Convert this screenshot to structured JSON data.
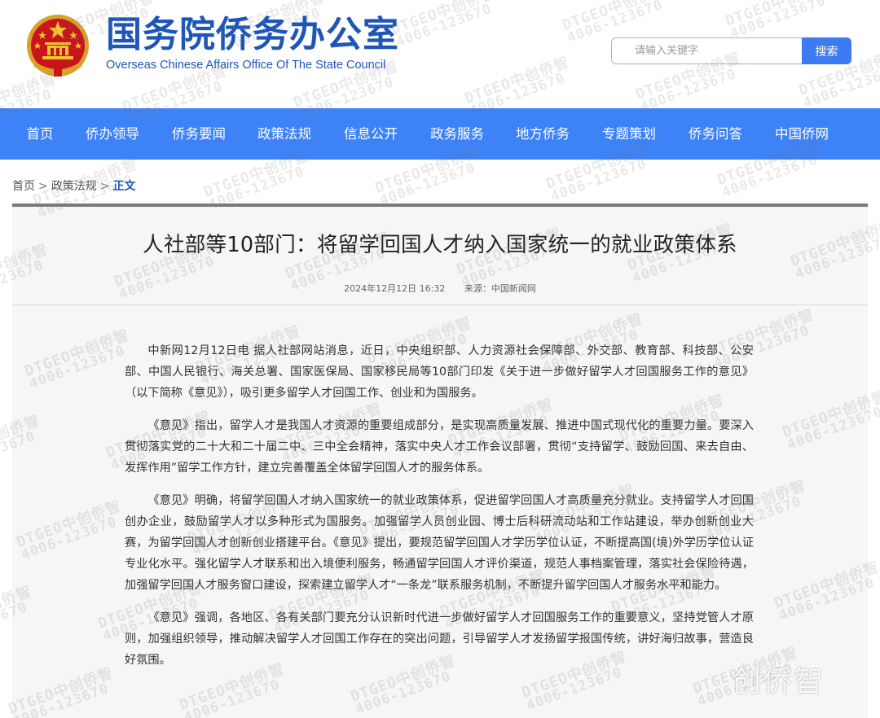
{
  "header": {
    "title": "国务院侨务办公室",
    "subtitle": "Overseas Chinese Affairs Office Of The State Council",
    "search_placeholder": "请输入关键字",
    "search_button": "搜索"
  },
  "nav": [
    {
      "label": "首页"
    },
    {
      "label": "侨办领导"
    },
    {
      "label": "侨务要闻"
    },
    {
      "label": "政策法规"
    },
    {
      "label": "信息公开"
    },
    {
      "label": "政务服务"
    },
    {
      "label": "地方侨务"
    },
    {
      "label": "专题策划"
    },
    {
      "label": "侨务问答"
    },
    {
      "label": "中国侨网"
    }
  ],
  "breadcrumb": {
    "home": "首页",
    "section": "政策法规",
    "current": "正文",
    "separator": ">"
  },
  "article": {
    "title": "人社部等10部门：将留学回国人才纳入国家统一的就业政策体系",
    "date": "2024年12月12日  16:32",
    "source": "来源：中国新闻网",
    "paragraphs": [
      "中新网12月12日电  据人社部网站消息，近日，中央组织部、人力资源社会保障部、外交部、教育部、科技部、公安部、中国人民银行、海关总署、国家医保局、国家移民局等10部门印发《关于进一步做好留学人才回国服务工作的意见》（以下简称《意见》），吸引更多留学人才回国工作、创业和为国服务。",
      "《意见》指出，留学人才是我国人才资源的重要组成部分，是实现高质量发展、推进中国式现代化的重要力量。要深入贯彻落实党的二十大和二十届二中、三中全会精神，落实中央人才工作会议部署，贯彻“支持留学、鼓励回国、来去自由、发挥作用”留学工作方针，建立完善覆盖全体留学回国人才的服务体系。",
      "《意见》明确，将留学回国人才纳入国家统一的就业政策体系，促进留学回国人才高质量充分就业。支持留学人才回国创办企业，鼓励留学人才以多种形式为国服务。加强留学人员创业园、博士后科研流动站和工作站建设，举办创新创业大赛，为留学回国人才创新创业搭建平台。《意见》提出，要规范留学回国人才学历学位认证，不断提高国(境)外学历学位认证专业化水平。强化留学人才联系和出入境便利服务，畅通留学回国人才评价渠道，规范人事档案管理，落实社会保险待遇，加强留学回国人才服务窗口建设，探索建立留学人才“一条龙”联系服务机制，不断提升留学回国人才服务水平和能力。",
      "《意见》强调，各地区、各有关部门要充分认识新时代进一步做好留学人才回国服务工作的重要意义，坚持党管人才原则，加强组织领导，推动解决留学人才回国工作存在的突出问题，引导留学人才发扬留学报国传统，讲好海归故事，营造良好氛围。"
    ]
  },
  "watermark": {
    "line1": "DTGEO中创侨智",
    "line2": "4006-123670",
    "corner": "创侨智"
  },
  "colors": {
    "brand_blue": "#1d55b8",
    "nav_blue": "#3e82f7",
    "button_blue": "#3d7bf2",
    "panel_bg": "#f6f6f6"
  }
}
